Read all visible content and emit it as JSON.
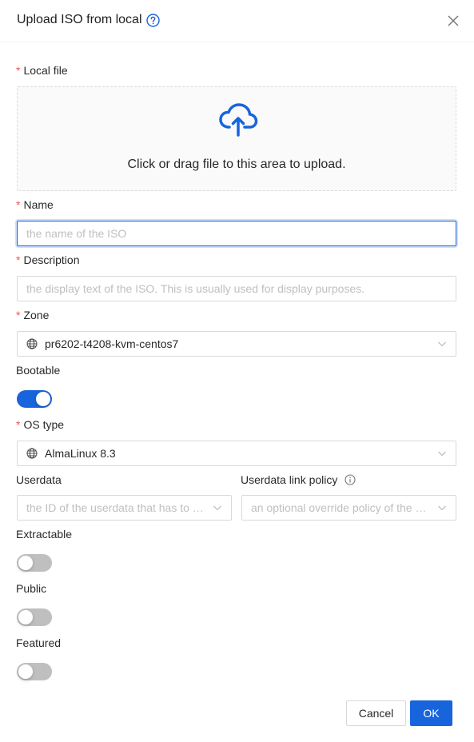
{
  "dialog": {
    "title": "Upload ISO from local",
    "accent_color": "#1864dc",
    "required_color": "#ff4d4f"
  },
  "fields": {
    "local_file": {
      "label": "Local file",
      "upload_text": "Click or drag file to this area to upload."
    },
    "name": {
      "label": "Name",
      "placeholder": "the name of the ISO",
      "value": ""
    },
    "description": {
      "label": "Description",
      "placeholder": "the display text of the ISO. This is usually used for display purposes.",
      "value": ""
    },
    "zone": {
      "label": "Zone",
      "value": "pr6202-t4208-kvm-centos7"
    },
    "bootable": {
      "label": "Bootable",
      "checked": true
    },
    "os_type": {
      "label": "OS type",
      "value": "AlmaLinux 8.3"
    },
    "userdata": {
      "label": "Userdata",
      "placeholder": "the ID of the userdata that has to …"
    },
    "userdata_link_policy": {
      "label": "Userdata link policy",
      "placeholder": "an optional override policy of the …"
    },
    "extractable": {
      "label": "Extractable",
      "checked": false
    },
    "public": {
      "label": "Public",
      "checked": false
    },
    "featured": {
      "label": "Featured",
      "checked": false
    }
  },
  "footer": {
    "cancel_label": "Cancel",
    "ok_label": "OK"
  },
  "icons": {
    "title_help": "question-circle-icon",
    "close": "close-icon",
    "upload": "cloud-upload-icon",
    "zone": "globe-icon",
    "os_type": "globe-icon",
    "dropdown": "chevron-down-icon",
    "info": "info-circle-icon"
  }
}
